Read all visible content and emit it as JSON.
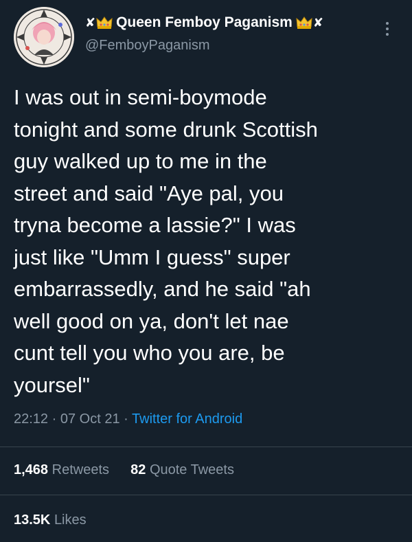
{
  "author": {
    "display_name": "Queen Femboy Paganism",
    "handle": "@FemboyPaganism",
    "left_decoration": "✘",
    "right_decoration": "✘",
    "crown_icon": "crown-icon"
  },
  "tweet": {
    "text": "I was out in semi-boymode\ntonight and some drunk Scottish\nguy walked up to me in the\nstreet and said \"Aye pal, you\ntryna become a lassie?\" I was\njust like \"Umm I guess\" super\nembarrassedly, and he said \"ah\nwell good on ya, don't let nae\ncunt tell you who you are, be\nyoursel\"",
    "time": "22:12",
    "separator": "·",
    "date": "07 Oct 21",
    "source": "Twitter for Android"
  },
  "stats": {
    "retweets_count": "1,468",
    "retweets_label": "Retweets",
    "quotes_count": "82",
    "quotes_label": "Quote Tweets",
    "likes_count": "13.5K",
    "likes_label": "Likes"
  },
  "colors": {
    "background": "#15202b",
    "text": "#ffffff",
    "muted": "#8b98a5",
    "link": "#1d9bf0",
    "divider": "#38444d"
  }
}
